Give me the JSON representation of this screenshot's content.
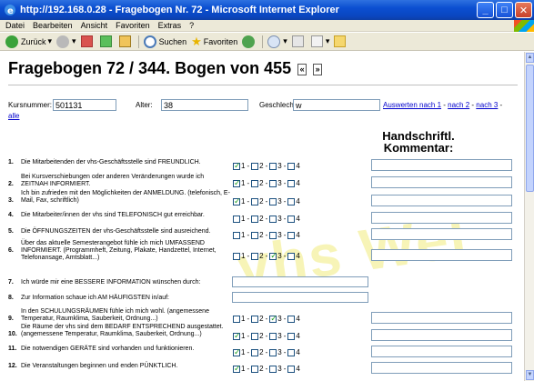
{
  "window": {
    "title": "http://192.168.0.28 - Fragebogen Nr. 72 - Microsoft Internet Explorer",
    "minimize": "_",
    "maximize": "□",
    "close": "✕"
  },
  "menu": [
    "Datei",
    "Bearbeiten",
    "Ansicht",
    "Favoriten",
    "Extras",
    "?"
  ],
  "toolbar": {
    "back_label": "Zurück",
    "search_label": "Suchen",
    "favorites_label": "Favoriten"
  },
  "page": {
    "title": "Fragebogen 72 / 344. Bogen von 455",
    "prev_button": "«",
    "next_button": "»",
    "watermark": "vhs Wel"
  },
  "filter": {
    "kursnummer_label": "Kursnummer:",
    "kursnummer_value": "501131",
    "alter_label": "Alter:",
    "alter_value": "38",
    "geschlecht_label": "Geschlecht:",
    "geschlecht_value": "w",
    "link1": "Auswerten nach 1",
    "sep1": " - ",
    "link2": "nach 2",
    "sep2": " - ",
    "link3": "nach 3",
    "sep3": " - ",
    "link4": "alle"
  },
  "column_heading": {
    "line1": "Handschriftl.",
    "line2": "Kommentar:"
  },
  "option_labels": [
    "1",
    "2",
    "3",
    "4"
  ],
  "questions": [
    {
      "num": "1.",
      "text": "Die Mitarbeitenden der vhs-Geschäftsstelle sind FREUNDLICH.",
      "checked": 1,
      "type": "scale"
    },
    {
      "num": "2.",
      "text": "Bei Kursverschiebungen oder anderen Veränderungen wurde ich ZEITNAH INFORMIERT.",
      "checked": 1,
      "type": "scale"
    },
    {
      "num": "3.",
      "text": "Ich bin zufrieden mit den Möglichkeiten der ANMELDUNG. (telefonisch, E-Mail, Fax, schriftlich)",
      "checked": 1,
      "type": "scale"
    },
    {
      "num": "4.",
      "text": "Die Mitarbeiter/innen der vhs sind TELEFONISCH gut erreichbar.",
      "checked": 0,
      "type": "scale"
    },
    {
      "num": "5.",
      "text": "Die ÖFFNUNGSZEITEN der vhs-Geschäftsstelle sind ausreichend.",
      "checked": 0,
      "type": "scale"
    },
    {
      "num": "6.",
      "text": "Über das aktuelle Semesterangebot fühle ich mich UMFASSEND INFORMIERT. (Programmheft, Zeitung, Plakate, Handzettel, Internet, Telefonansage, Amtsblatt...)",
      "checked": 3,
      "type": "scale"
    },
    {
      "num": "7.",
      "text": "Ich würde mir eine BESSERE INFORMATION wünschen durch:",
      "checked": 0,
      "type": "text"
    },
    {
      "num": "8.",
      "text": "Zur Information schaue ich AM HÄUFIGSTEN in/auf:",
      "checked": 0,
      "type": "text"
    },
    {
      "num": "9.",
      "text": "In den SCHULUNGSRÄUMEN fühle ich mich wohl. (angemessene Temperatur, Raumklima, Sauberkeit, Ordnung...)",
      "checked": 3,
      "type": "scale"
    },
    {
      "num": "10.",
      "text": "Die Räume der vhs sind dem BEDARF ENTSPRECHEND ausgestattet. (angemessene Temperatur, Raumklima, Sauberkeit, Ordnung...)",
      "checked": 1,
      "type": "scale"
    },
    {
      "num": "11.",
      "text": "Die notwendigen GERÄTE sind vorhanden und funktionieren.",
      "checked": 1,
      "type": "scale"
    },
    {
      "num": "12.",
      "text": "Die Veranstaltungen beginnen und enden PÜNKTLICH.",
      "checked": 1,
      "type": "scale"
    }
  ]
}
